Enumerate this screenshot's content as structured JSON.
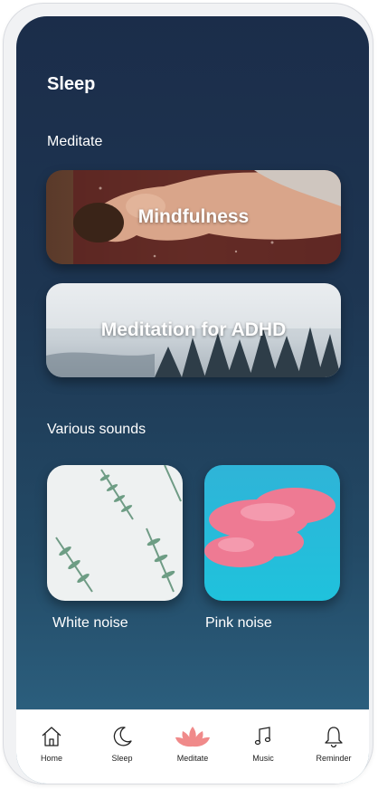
{
  "header": {
    "title": "Sleep"
  },
  "meditate": {
    "section_label": "Meditate",
    "cards": [
      {
        "label": "Mindfulness"
      },
      {
        "label": "Meditation for ADHD"
      }
    ]
  },
  "sounds": {
    "section_label": "Various sounds",
    "tiles": [
      {
        "label": "White noise"
      },
      {
        "label": "Pink noise"
      }
    ]
  },
  "tabbar": {
    "items": [
      {
        "label": "Home",
        "icon": "home-icon"
      },
      {
        "label": "Sleep",
        "icon": "moon-icon"
      },
      {
        "label": "Meditate",
        "icon": "lotus-icon",
        "active": true
      },
      {
        "label": "Music",
        "icon": "music-note-icon"
      },
      {
        "label": "Reminder",
        "icon": "bell-icon"
      }
    ]
  },
  "colors": {
    "background_top": "#1b2d4a",
    "background_bottom": "#2f6888",
    "lotus": "#f08a8a",
    "text": "#ffffff"
  }
}
